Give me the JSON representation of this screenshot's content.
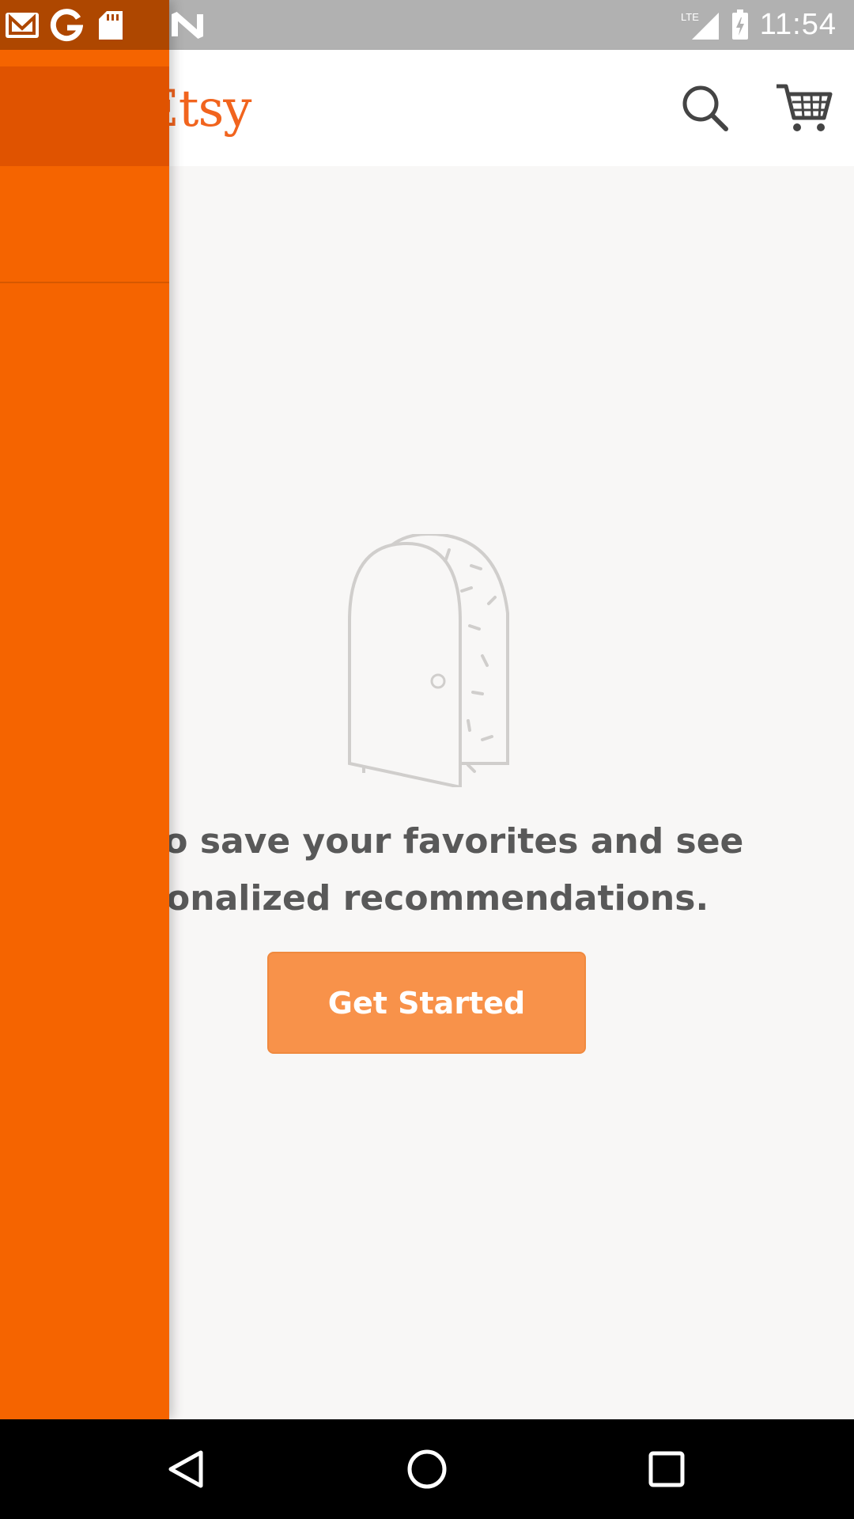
{
  "status_bar": {
    "time": "11:54",
    "network": "LTE",
    "notification_icons": [
      "gmail-icon",
      "google-icon",
      "sd-card-icon",
      "n-icon"
    ]
  },
  "app_bar": {
    "logo": "Etsy",
    "actions": [
      "search-icon",
      "cart-icon"
    ]
  },
  "main": {
    "message_line1": "n to save your favorites and see",
    "message_line2": "sonalized recommendations.",
    "cta_label": "Get Started"
  },
  "nav_bar": {
    "buttons": [
      "back-icon",
      "home-icon",
      "recents-icon"
    ]
  },
  "colors": {
    "brand_orange": "#f56400",
    "cta_orange": "#f8924a",
    "text_gray": "#595959",
    "background": "#f8f7f6"
  }
}
